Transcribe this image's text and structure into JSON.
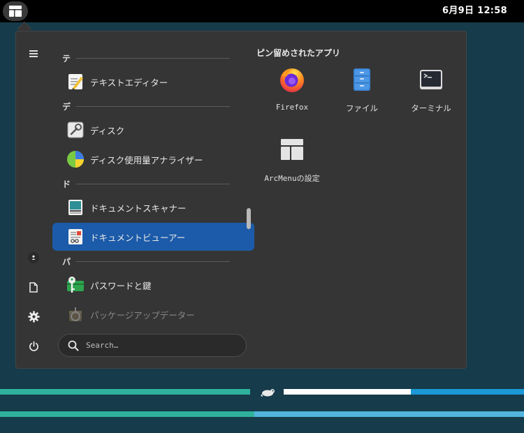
{
  "topbar": {
    "clock": "6月9日  12:58"
  },
  "menu": {
    "sections": [
      {
        "letter": "テ"
      },
      {
        "letter": "デ"
      },
      {
        "letter": "ド"
      },
      {
        "letter": "パ"
      }
    ],
    "apps": [
      {
        "label": "テキストエディター",
        "icon": "text-editor-icon"
      },
      {
        "label": "ディスク",
        "icon": "disks-icon"
      },
      {
        "label": "ディスク使用量アナライザー",
        "icon": "disk-usage-icon"
      },
      {
        "label": "ドキュメントスキャナー",
        "icon": "scanner-icon"
      },
      {
        "label": "ドキュメントビューアー",
        "icon": "document-viewer-icon",
        "active": true
      },
      {
        "label": "パスワードと鍵",
        "icon": "passwords-keys-icon"
      },
      {
        "label": "パッケージアップデーター",
        "icon": "package-updater-icon"
      }
    ],
    "search": {
      "placeholder": "Search…"
    },
    "pinned": {
      "title": "ピン留めされたアプリ",
      "items": [
        {
          "label": "Firefox",
          "icon": "firefox-icon"
        },
        {
          "label": "ファイル",
          "icon": "files-icon"
        },
        {
          "label": "ターミナル",
          "icon": "terminal-icon"
        },
        {
          "label": "ArcMenuの設定",
          "icon": "arcmenu-settings-icon"
        }
      ]
    }
  },
  "colors": {
    "accent": "#1c5ba9",
    "desktop": "#163b4a",
    "stripe_teal": "#2fb8a0",
    "stripe_blue": "#1a9ad6",
    "stripe_lightblue": "#4fb6e0"
  }
}
